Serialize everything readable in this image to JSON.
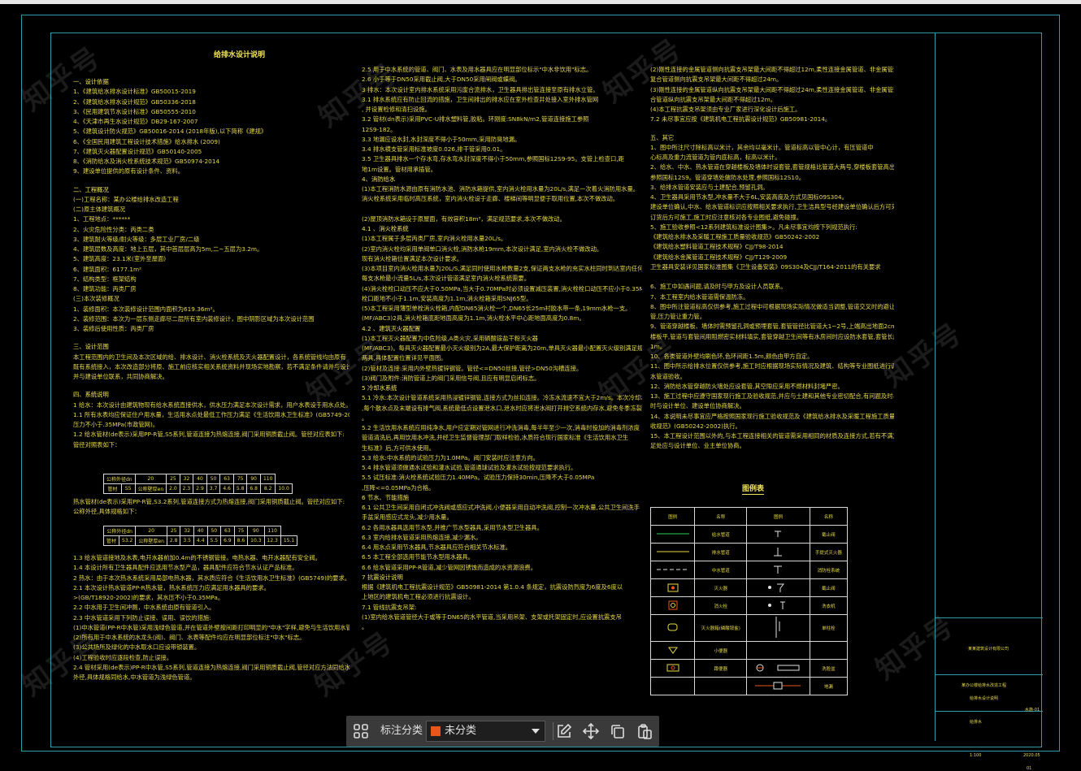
{
  "drawing": {
    "title": "给排水设计说明"
  },
  "columns": {
    "col1": [
      {
        "t": "一、设计依据",
        "h": true
      },
      {
        "t": "1、《建筑给水排水设计标准》GB50015-2019"
      },
      {
        "t": "2、《建筑给水排水设计规范》GB50336-2018"
      },
      {
        "t": "3、《民用建筑节水设计标准》GB50555-2010"
      },
      {
        "t": "4、《天津市再生水设计规范》DB29-167-2007"
      },
      {
        "t": "5、《建筑设计防火规范》GB50016-2014 (2018年版),以下简称《建规》"
      },
      {
        "t": "6、《全国民用建筑工程设计技术措施》给水排水 (2009)"
      },
      {
        "t": "7、《建筑灭火器配置设计规范》GB50140-2005"
      },
      {
        "t": "8、《消防给水及消火栓系统技术规范》GB50974-2014"
      },
      {
        "t": "9、建设单位提供的原有设计条件、资料。"
      },
      {
        "t": "",
        "gap": true
      },
      {
        "t": "二、工程概况",
        "h": true
      },
      {
        "t": "(一)工程名称：某办公楼给排水改造工程"
      },
      {
        "t": "(二)原主体建筑概况"
      },
      {
        "t": "1、工程地点：******"
      },
      {
        "t": "2、火灾危险性分类：丙类二类"
      },
      {
        "t": "3、建筑耐火等级/耐火等级：多层工业厂房/二级"
      },
      {
        "t": "4、建筑层数及高度：地上五层，其中首层层高为5m,二~五层为3.2m。"
      },
      {
        "t": "5、建筑高度：23.1米(室外至屋面)"
      },
      {
        "t": "6、建筑面积：6177.1m²"
      },
      {
        "t": "7、结构类型：框架结构"
      },
      {
        "t": "8、建筑功能：丙类厂房"
      },
      {
        "t": "(三)本次装修概况"
      },
      {
        "t": "1、装修面积：本次装修设计范围内面积为619.36m²。"
      },
      {
        "t": "2、装修范围：本次为一层东侧走廊尽二层所有室内装修设计，图中阴影区域为本次设计范围"
      },
      {
        "t": "3、装修后使用性质：丙类厂房"
      },
      {
        "t": "",
        "gap": true
      },
      {
        "t": "三、设计范围",
        "h": true
      },
      {
        "t": "    本工程范围内的卫生间及本次区域的给、排水设计、消火栓系统及灭火器配置设计，各系统管线均由原有"
      },
      {
        "t": "既有系统接入，本次改造部分将原、施工前应核实相关系统资料并现场实地勘察，若不满足条件请并与设计"
      },
      {
        "t": "并与建设单位联系，共同协商解决。"
      },
      {
        "t": "",
        "gap": true
      },
      {
        "t": "四、系统说明",
        "h": true
      },
      {
        "t": "  1 给水：本次设计由建筑物现有给水系统直接供水，供水压力满足本次设计需求，用户水表设于用水点处。"
      },
      {
        "t": "    1.1 所有水表均应保证住户用水量，生活用水点处最低工作压力满足《生活饮用水卫生标准》(GB5749-2012)的要求，压力"
      },
      {
        "t": "    压力不小于.35MPa(市政管网)。"
      },
      {
        "t": "    1.2 给水管材(de表示)采用PP-R管,S5系列,管道连接为热熔连接,阀门采用铜质截止阀。管径对应表如下:"
      },
      {
        "t": "    管径对照表如下："
      }
    ],
    "col1b": [
      {
        "t": "        热水管材(de表示)采用PP-R管,S3.2系列,管道连接方式为热熔连接,阀门采用铜质截止阀。管径对应如下:"
      },
      {
        "t": "    公称外径,具体规格如下："
      }
    ],
    "col1c": [
      {
        "t": "    1.3 给水管道接地及水表,电开水器前加0.4m的不锈钢管接。电热水器、电开水器配有安全阀。"
      },
      {
        "t": "    1.4 本设计所有卫生器具配件应选用节水型产品，器具配件应符合节水认证产品标准。"
      },
      {
        "t": "  2 热水：由于本次热水系统采用局部电热水器，其水质应符合《生活饮用水卫生标准》(GB5749)的要求。"
      },
      {
        "t": "    2.1 本次设计热水管道PP-R热水管，热水系统压力应满足用水器具的要求。"
      },
      {
        "t": ">(GB/T18920-2002)的要求，其水压不小于0.35MPa。"
      },
      {
        "t": "    2.2 中水用于卫生间冲厕，中水系统由原有管道引入。"
      },
      {
        "t": "    2.3 中水管道采用下列防止误接、误用、误饮的措施:"
      },
      {
        "t": "  (1)中水管道(PP-R中水管)采用浅绿色管道,并在管道外壁按间距打印明显的\"中水\"字样,避免与生活饮用水管道混淆。"
      },
      {
        "t": "  (2)所有用于中水系统的水龙头(阀)、阀门、水表等配件均应在明显部位标注\"中水\"标志。"
      },
      {
        "t": "  (3)公共场所及绿化的中水取水口应设带锁装置。"
      },
      {
        "t": "  (4)工程验收时应逐段检查,防止误接。"
      },
      {
        "t": "    2.4 管材采用(de表示)PP-R中水管,S5系列,管道连接为热熔连接,阀门采用铜质截止阀,管径对应方法同给水"
      },
      {
        "t": "外径,具体规格同给水,中水管道为浅绿色管道。"
      }
    ],
    "col2": [
      {
        "t": "2.5  用于中水系统的管道、阀门、水表及用水器具应在明显部位标示\"中水非饮用\"标志。"
      },
      {
        "t": "2.6  小于等于DN50采用截止阀,大于DN50采用闸阀或蝶阀。"
      },
      {
        "t": "3 排水：本次设计室内排水系统采用污废合流排水，卫生器具排出管连接至原有排水立管。"
      },
      {
        "t": "3.1 排水系统应有防止回流的措施，卫生间排出的排水应在室外检查井处接入室外排水管网"
      },
      {
        "t": ", 并设置检修和清扫设施。"
      },
      {
        "t": "3.2  管材(dn表示)采用PVC-U排水塑料管,胶粘。环刚度:SN8kN/m2,管道连接施工参照"
      },
      {
        "t": "12S9-182。"
      },
      {
        "t": "3.3  地漏应设水封,水封深度不得小于50mm,采用防臭地漏。"
      },
      {
        "t": "3.4  排水横支管采用标准坡度0.026,排干管采用0.01。"
      },
      {
        "t": "3.5  卫生器具排水一个存水弯,存水弯水封深度不得小于50mm,参照国标12S9-95。支管上检查口,距"
      },
      {
        "t": "地1m设置。管材用承插管。"
      },
      {
        "t": "4、消防给水",
        "h": true
      },
      {
        "t": "(1)本工程消防水源由原有消防水池、消防水箱提供,室内消火栓用水量为20L/s,满足一次着火消防用水量。"
      },
      {
        "t": "消火栓系统采用临时高压系统，室内消火栓设于走廊、楼梯间等明显便于取用位置,本次不做改动。"
      },
      {
        "t": ""
      },
      {
        "t": "(2)屋顶消防水箱设于原屋面，有效容积18m³，满足规范要求,本次不做改动。"
      },
      {
        "t": "4.1 、消火栓系统",
        "h": true
      },
      {
        "t": "(1)本工程属于多层丙类厂房,室内消火栓用水量20L/s。"
      },
      {
        "t": "(2)室内消火栓均采用单阀单口消火栓,消防水枪19mm,本次设计满足,室内消火栓不做改动。"
      },
      {
        "t": "现有消火栓箱位置满足本次设计要求。"
      },
      {
        "t": "(3)本项目室内消火栓用水量为20L/S,满足同时使用水枪数量2支,保证两支水枪的充实水柱同时到达室内任何部位。"
      },
      {
        "t": "每支水枪最小流量5L/s,本次设计管道满足室内消火栓系统需要。"
      },
      {
        "t": "(4)消火栓栓口动压不应大于0.50MPa,当大于0.70MPa时必须设置减压装置,消火栓栓口动压不应小于0.35MPa。"
      },
      {
        "t": "栓口距地不小于1.1m,安装高度为1.1m,消火栓箱采用SNJ65型。"
      },
      {
        "t": "(5)本工程采用薄型单栓消火栓箱,内配DN65消火栓一个,DN65长25m衬胶水带一条,19mm水枪一支。"
      },
      {
        "t": "(MF/ABC3)2具,消火栓箱底距地面高度为1.1m,消火栓水平中心距地面高度为0.8m。"
      },
      {
        "t": "4.2 、建筑灭火器配置",
        "h": true
      },
      {
        "t": "(1)本工程灭火器配置为中危险级,A类火灾,采用磷酸铵盐干粉灭火器"
      },
      {
        "t": "(MF/ABC3)。每具灭火器配置最小灭火级别为2A,最大保护距离为20m,单具灭火器最小配置灭火级别满足规范要求。"
      },
      {
        "t": "两具,具体配置位置详见平面图。"
      },
      {
        "t": "(2)管材及连接:采用内外壁热镀锌钢管。管径<=DN50丝接,管径>DN50沟槽连接。"
      },
      {
        "t": "(3)阀门及附件:消防管道上的阀门采用信号阀,且应有明显启闭标志。"
      },
      {
        "t": "5 冷却水系统",
        "h": true
      },
      {
        "t": "5.1 冷水:本次设计管道系统采用热浸镀锌钢管,连接方式为丝扣连接。冷冻水流速不宜大于2m/s。本次冷却水系统"
      },
      {
        "t": ",每个散水点及末端设有排气阀,系统最低点设置泄水口,泄水时应将泄水阀打开排空系统内存水,避免冬季冻裂管道。"
      },
      {
        "t": "。"
      },
      {
        "t": "5.2 生活饮用水系统应用纯净水,用户应定期对管网进行冲洗消毒,每半年至少一次,消毒时投加的消毒剂浓度"
      },
      {
        "t": "管道清洗后,再用饮用水冲洗,并经卫生监督管理部门取样检验,水质符合现行国家标准《生活饮用水卫生"
      },
      {
        "t": "生标准》后,方可供水使用。"
      },
      {
        "t": "5.3  给水:中水系统的试验压力为1.0MPa。阀门安装时应注意方向。"
      },
      {
        "t": "5.4  排水管道须做通水试验和灌水试验,管道通球试验及灌水试验按规范要求执行。"
      },
      {
        "t": "5.5  试压标准:消火栓系统试验压力1.40MPa。试验压力保持30min,压降不大于0.05MPa"
      },
      {
        "t": ",压降<=0.05MPa为合格。"
      },
      {
        "t": "6  节水、节能措施",
        "h": true
      },
      {
        "t": "6.1  公共卫生间采用自闭式冲洗阀或感应式冲洗阀,小便器采用自动冲洗阀,控制一次冲水量,公共卫生间洗手"
      },
      {
        "t": "手盆采用感应式龙头,减少用水量。"
      },
      {
        "t": "6.2  各用水器具选用节水型,并推广节水型器具,采用节水型卫生器具。"
      },
      {
        "t": "6.3  室内给排水管道采用热熔连接,减少漏水。"
      },
      {
        "t": "6.4  用水点采用节水器具,节水器具应符合相关节水标准。"
      },
      {
        "t": "6.5  本工程全部选用节能节水型用水器具。"
      },
      {
        "t": "6.6  给水管道采用PP-R管道,减少管网因锈蚀而造成的水资源浪费。"
      },
      {
        "t": "7  抗震设计说明",
        "h": true
      },
      {
        "t": "    根据《建筑机电工程抗震设计规范》GB50981-2014 第1.0.4 条规定，抗震设防烈度为6度及6度以"
      },
      {
        "t": "上地区的建筑机电工程必须进行抗震设计。"
      },
      {
        "t": "7.1  管线抗震支吊架:"
      },
      {
        "t": "(1)室内给水管道管径大于或等于DN65的水平管道,当采用吊架、支架或托架固定时,应设置抗震支吊"
      },
      {
        "t": "。"
      }
    ],
    "col3": [
      {
        "t": "(2)刚性连接的金属管道侧向抗震支吊架最大间距不得超过12m,柔性连接金属管道、非金属管道及"
      },
      {
        "t": "复合管道侧向抗震支吊架最大间距不得超过24m。"
      },
      {
        "t": "(3)刚性连接的金属管道纵向抗震支吊架最大间距不得超过24m,柔性连接金属管道、非金属管道及复"
      },
      {
        "t": "合管道纵向抗震支吊架最大间距不得超过12m。"
      },
      {
        "t": "(4)本工程抗震支吊架须由专业厂家进行深化设计后施工。"
      },
      {
        "t": "7.2  未尽事宜应按《建筑机电工程抗震设计规范》GB50981-2014。"
      },
      {
        "t": "",
        "gap": true
      },
      {
        "t": "五、其它",
        "h": true
      },
      {
        "t": "1、图中所注尺寸除标高以米计，其余均以毫米计。管道标高以管中心计，有压管道中"
      },
      {
        "t": "心标高及重力流管道为管内底标高，标高以米计。"
      },
      {
        "t": "2、给水、中水、热水管道在穿越楼板及墙体时设套管,套管规格比管道大两号,穿楼板套管高出地面50mm,"
      },
      {
        "t": "参照国标12S9。管道穿墙处做防水处理,参照国标12S10。"
      },
      {
        "t": "3、给排水管道安装应与土建配合,预留孔洞。"
      },
      {
        "t": "4、卫生器具采用节水型,冲水量不大于6L,安装高度及方式见国标09S304。"
      },
      {
        "t": "建设单位确认,中水、给水管道标识应按照相关要求执行,卫生洁具型号经建设单位确认后方可采购,"
      },
      {
        "t": "订货后方可施工,施工时应注意核对各专业图纸,避免碰撞。"
      },
      {
        "t": "5、施工验收参照<12系列建筑标准设计图集>。凡未尽事宜均按下列规范执行:"
      },
      {
        "t": "《建筑给水排水及采暖工程施工质量验收规范》GB50242-2002"
      },
      {
        "t": "《建筑给水塑料管道工程技术规程》CJJ/T98-2014"
      },
      {
        "t": "《建筑给水金属管道工程技术规程》CJJ/T129-2009"
      },
      {
        "t": "卫生器具安装详见国家标准图集《卫生设备安装》09S304及CJJ/T164-2011的有关要求"
      },
      {
        "t": ""
      },
      {
        "t": "6、施工中如遇问题,请及时与甲方及设计人员联系。"
      },
      {
        "t": "7、本工程室内给水管道需保温防冻。"
      },
      {
        "t": "8、图中所注管道标高仅供参考,施工过程中可根据现场实际情况做适当调整,管道交叉时的避让原则为小管让大"
      },
      {
        "t": "管,压力管让重力管。"
      },
      {
        "t": "9、管道穿越楼板、墙体时需预留孔洞或预埋套管,套管管径比管道大1~2号,上端高出地面2cm,下端与"
      },
      {
        "t": "楼板平,管道与套管间用阻燃密实材料填实,套管穿越卫生间等有水房间时应设防水套管,套管长度"
      },
      {
        "t": "1m。"
      },
      {
        "t": "10、各类管道外壁均刷色环,色环间距1.5m,颜色由甲方自定。"
      },
      {
        "t": "11、图中所示给排水位置仅供参考,施工时应根据现场实际情况及建筑、结构等专业图纸进行调整,给排"
      },
      {
        "t": "水管道验收。"
      },
      {
        "t": "12、消防给水管穿越防火墙处应设套管,其空隙应采用不燃材料封堵严密。"
      },
      {
        "t": "13、施工过程中应遵守国家现行施工及验收规范,并应与土建和其他专业密切配合,有问题及时与设计"
      },
      {
        "t": "时与设计单位、建设单位协商解决。"
      },
      {
        "t": "14、本说明未尽事宜应严格按照国家现行施工验收规范及《建筑给水排水及采暖工程施工质量验"
      },
      {
        "t": "收规范》(GB50242-2002)执行。"
      },
      {
        "t": "15、本工程设计范围以外的,与本工程连接相关的管道需采用相同的材质及连接方式,若有不满足"
      },
      {
        "t": "足处应与设计单位、业主单位协商。"
      }
    ]
  },
  "spec_table_1": {
    "row1_label": "公称外径dn",
    "row2_label_a": "管材",
    "row2_label_b": "S5",
    "row2_label_c": "公称壁厚en",
    "sizes": [
      "20",
      "25",
      "32",
      "40",
      "50",
      "63",
      "75",
      "90",
      "110"
    ],
    "walls": [
      "2.0",
      "2.3",
      "2.9",
      "3.7",
      "4.6",
      "5.8",
      "6.8",
      "8.2",
      "10.0"
    ]
  },
  "spec_table_2": {
    "row1_label": "公称外径dn",
    "row2_label_a": "管材",
    "row2_label_b": "S3.2",
    "row2_label_c": "公称壁厚en",
    "sizes": [
      "20",
      "25",
      "32",
      "40",
      "50",
      "63",
      "75",
      "90",
      "110"
    ],
    "walls": [
      "2.8",
      "3.5",
      "4.4",
      "5.5",
      "6.9",
      "8.6",
      "10.3",
      "12.3",
      "15.1"
    ]
  },
  "legend": {
    "title": "图例表",
    "headers": [
      "图例",
      "名称",
      "图例",
      "名称"
    ],
    "rows": [
      {
        "n1": "给水管道",
        "n2": "截止阀"
      },
      {
        "n1": "排水管道",
        "n2": "手提式灭火器"
      },
      {
        "n1": "中水管道",
        "n2": "消防栓系统"
      },
      {
        "n1": "灭火器",
        "n2": "截止阀"
      },
      {
        "n1": "消火栓",
        "n2": "洗衣机"
      },
      {
        "n1": "灭火器箱(磷酸铵盐)",
        "n2": "单柱栓"
      },
      {
        "n1": "小便器",
        "n2": ""
      },
      {
        "n1": "蹲便器",
        "n2": "洗脸盆"
      },
      {
        "n1": "",
        "n2": "地漏"
      }
    ]
  },
  "title_block": {
    "company": "某某建筑设计有限公司",
    "project": "某办公楼给排水改造工程",
    "sheet": "给排水",
    "drawing_name": "给排水设计说明",
    "scale": "1:100",
    "date": "2020.05",
    "number": "水施-01",
    "page": "01"
  },
  "watermark": {
    "text": "知乎号"
  },
  "toolbar": {
    "grid_icon": "grid-icon",
    "label": "标注分类",
    "selected": "未分类",
    "swatch_color": "#e8561c",
    "edit_icon": "edit-icon",
    "move_icon": "move-icon",
    "copy_icon": "copy-icon",
    "paste_icon": "paste-icon"
  }
}
